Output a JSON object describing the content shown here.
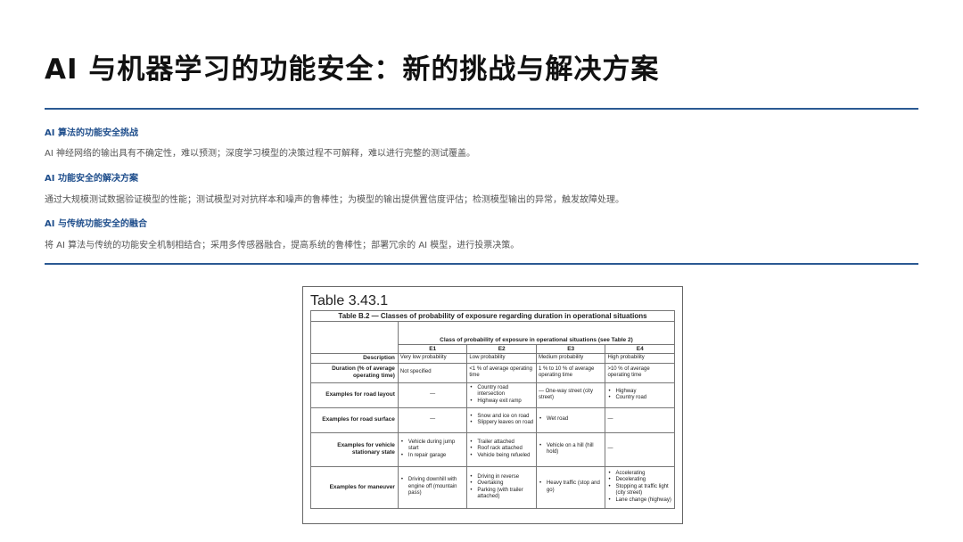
{
  "slide": {
    "title": "AI 与机器学习的功能安全：新的挑战与解决方案"
  },
  "sections": [
    {
      "heading": "AI 算法的功能安全挑战",
      "body": "AI 神经网络的输出具有不确定性，难以预测；深度学习模型的决策过程不可解释，难以进行完整的测试覆盖。"
    },
    {
      "heading": "AI 功能安全的解决方案",
      "body": "通过大规模测试数据验证模型的性能；测试模型对对抗样本和噪声的鲁棒性；为模型的输出提供置信度评估；检测模型输出的异常，触发故障处理。"
    },
    {
      "heading": "AI 与传统功能安全的融合",
      "body": "将 AI 算法与传统的功能安全机制相结合；采用多传感器融合，提高系统的鲁棒性；部署冗余的 AI 模型，进行投票决策。"
    }
  ],
  "figure": {
    "caption": "Table 3.43.1",
    "table_title": "Table B.2 — Classes of probability of exposure regarding duration in operational situations",
    "group_header": "Class of probability of exposure in operational situations (see Table 2)",
    "columns": [
      "E1",
      "E2",
      "E3",
      "E4"
    ],
    "rows": {
      "description": {
        "label": "Description",
        "cells": [
          "Very low probability",
          "Low probability",
          "Medium probability",
          "High probability"
        ]
      },
      "duration": {
        "label": "Duration (% of average operating time)",
        "cells": [
          "Not specified",
          "<1 % of average operating time",
          "1 % to 10 % of average operating time",
          ">10 % of average operating time"
        ]
      },
      "road_layout": {
        "label": "Examples for road layout",
        "e1": "—",
        "e2": [
          "Country road intersection",
          "Highway exit ramp"
        ],
        "e3": "— One-way street (city street)",
        "e4": [
          "Highway",
          "Country road"
        ]
      },
      "road_surface": {
        "label": "Examples for road surface",
        "e1": "—",
        "e2": [
          "Snow and ice on road",
          "Slippery leaves on road"
        ],
        "e3": [
          "Wet road"
        ],
        "e4": "—"
      },
      "vehicle_state": {
        "label": "Examples for vehicle stationary state",
        "e1": [
          "Vehicle during jump start",
          "In repair garage"
        ],
        "e2": [
          "Trailer attached",
          "Roof rack attached",
          "Vehicle being refueled"
        ],
        "e3": [
          "Vehicle on a hill (hill hold)"
        ],
        "e4": "—"
      },
      "maneuver": {
        "label": "Examples for maneuver",
        "e1": [
          "Driving downhill with engine off (mountain pass)"
        ],
        "e2": [
          "Driving in reverse",
          "Overtaking",
          "Parking (with trailer attached)"
        ],
        "e3": [
          "Heavy traffic (stop and go)"
        ],
        "e4": [
          "Accelerating",
          "Decelerating",
          "Stopping at traffic light (city street)",
          "Lane change (highway)"
        ]
      }
    }
  },
  "colors": {
    "accent_rule": "#2b5a93",
    "heading": "#1f4e8c"
  }
}
